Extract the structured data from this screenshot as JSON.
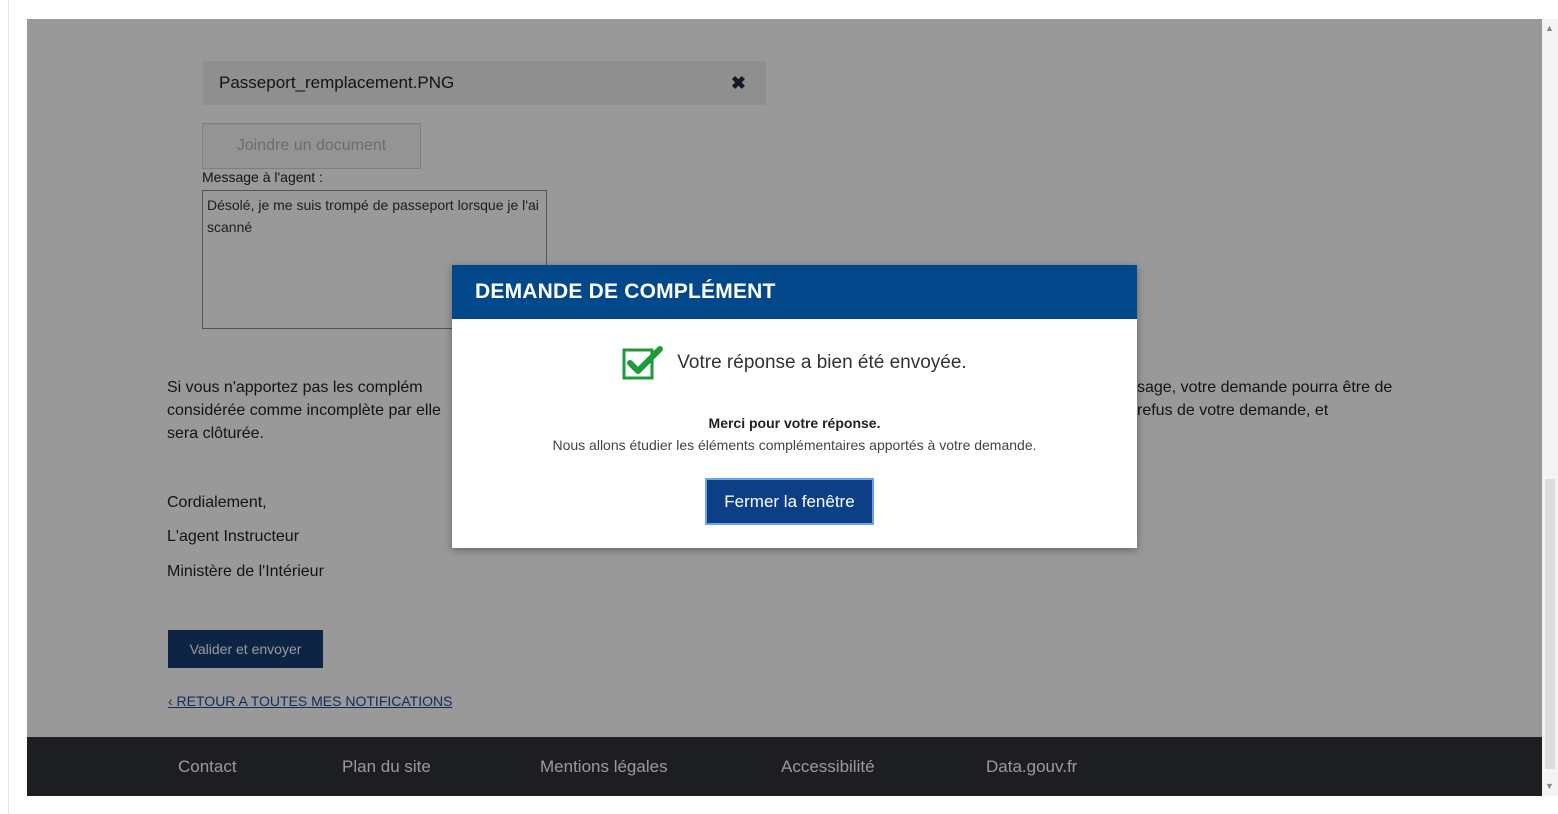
{
  "attachment": {
    "file_name": "Passeport_remplacement.PNG",
    "remove_symbol": "✖",
    "attach_label": "Joindre un document"
  },
  "message": {
    "label": "Message à l'agent :",
    "value": "Désolé, je me suis trompé de passeport lorsque je l'ai scanné"
  },
  "notice": {
    "left_text": "Si vous n'apportez pas les complém considérée comme incomplète par elle sera clôturée.",
    "right_text": "sage, votre demande pourra être de refus de votre demande, et"
  },
  "signature": {
    "closing": "Cordialement,",
    "role": "L'agent Instructeur",
    "ministry": "Ministère de l'Intérieur"
  },
  "actions": {
    "submit_label": "Valider et envoyer",
    "back_link": "‹ RETOUR A TOUTES MES NOTIFICATIONS"
  },
  "footer": {
    "links": [
      "Contact",
      "Plan du site",
      "Mentions légales",
      "Accessibilité",
      "Data.gouv.fr"
    ]
  },
  "modal": {
    "title": "DEMANDE DE COMPLÉMENT",
    "success_message": "Votre réponse a bien été envoyée.",
    "thanks": "Merci pour votre réponse.",
    "details": "Nous allons étudier les éléments complémentaires apportés à votre demande.",
    "close_label": "Fermer la fenêtre",
    "icon": "check-icon"
  },
  "colors": {
    "modal_header": "#04488c",
    "primary_button": "#0d3f86",
    "footer_bg": "#2f3237",
    "check_green": "#1f9a3a"
  }
}
